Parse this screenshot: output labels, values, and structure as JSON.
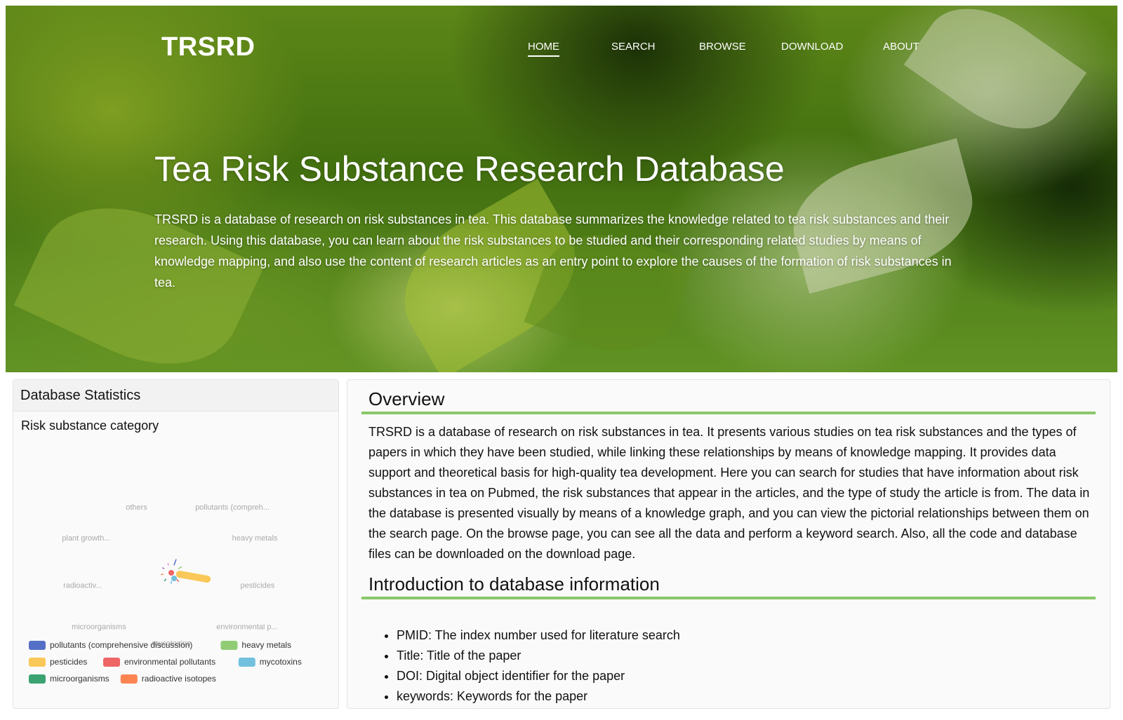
{
  "header": {
    "logo": "TRSRD",
    "nav": [
      {
        "label": "HOME",
        "active": true
      },
      {
        "label": "SEARCH",
        "active": false
      },
      {
        "label": "BROWSE",
        "active": false
      },
      {
        "label": "DOWNLOAD",
        "active": false
      },
      {
        "label": "ABOUT",
        "active": false
      }
    ]
  },
  "hero": {
    "title": "Tea Risk Substance Research Database",
    "description": "TRSRD is a database of research on risk substances in tea. This database summarizes the knowledge related to tea risk substances and their research. Using this database, you can learn about the risk substances to be studied and their corresponding related studies by means of knowledge mapping, and also use the content of research articles as an entry point to explore the causes of the formation of risk substances in tea."
  },
  "stats": {
    "title": "Database Statistics",
    "subtitle": "Risk substance category"
  },
  "chart_data": {
    "type": "pie",
    "variant": "nightingale-rose",
    "title": "",
    "categories": [
      "pollutants (compreh...",
      "heavy metals",
      "pesticides",
      "environmental p...",
      "mycotoxins",
      "microorganisms",
      "radioactiv...",
      "plant growth...",
      "others"
    ],
    "legend": [
      {
        "name": "pollutants (comprehensive discussion)",
        "color": "#5470c6"
      },
      {
        "name": "heavy metals",
        "color": "#91cc75"
      },
      {
        "name": "pesticides",
        "color": "#fac858"
      },
      {
        "name": "environmental pollutants",
        "color": "#ee6666"
      },
      {
        "name": "mycotoxins",
        "color": "#73c0de"
      },
      {
        "name": "microorganisms",
        "color": "#3ba272"
      },
      {
        "name": "radioactive isotopes",
        "color": "#fc8452"
      }
    ],
    "values": [
      20,
      12,
      100,
      10,
      8,
      7,
      6,
      5,
      4
    ],
    "slice_colors": [
      "#5470c6",
      "#91cc75",
      "#fac858",
      "#ee6666",
      "#73c0de",
      "#3ba272",
      "#fc8452",
      "#9a60b4",
      "#ea7ccc"
    ],
    "legend_position": "bottom"
  },
  "overview": {
    "title": "Overview",
    "text": "TRSRD is a database of research on risk substances in tea. It presents various studies on tea risk substances and the types of papers in which they have been studied, while linking these relationships by means of knowledge mapping. It provides data support and theoretical basis for high-quality tea development. Here you can search for studies that have information about risk substances in tea on Pubmed, the risk substances that appear in the articles, and the type of study the article is from. The data in the database is presented visually by means of a knowledge graph, and you can view the pictorial relationships between them on the search page. On the browse page, you can see all the data and perform a keyword search. Also, all the code and database files can be downloaded on the download page.",
    "intro_title": "Introduction to database information",
    "items": [
      "PMID: The index number used for literature search",
      "Title: Title of the paper",
      "DOI: Digital object identifier for the paper",
      "keywords: Keywords for the paper"
    ]
  }
}
